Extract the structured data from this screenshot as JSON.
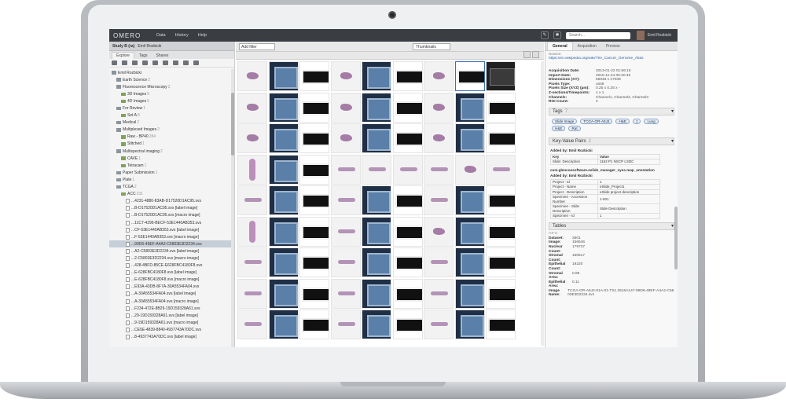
{
  "app": {
    "logo": "OMERO",
    "menu": [
      "Data",
      "History",
      "Help"
    ],
    "search_placeholder": "Search...",
    "user_name": "Emil Rozbicki"
  },
  "left": {
    "header_title": "Study B (ra)",
    "header_user": "Emil Rozbicki",
    "tabs": [
      "Explore",
      "Tags",
      "Shares"
    ],
    "tree": [
      {
        "indent": 0,
        "type": "user",
        "label": "Emil Rozbicki",
        "count": ""
      },
      {
        "indent": 1,
        "type": "folder-gray",
        "label": "Earth Science",
        "count": "2"
      },
      {
        "indent": 1,
        "type": "folder-gray",
        "label": "Fluorescence Microscopy",
        "count": "2"
      },
      {
        "indent": 2,
        "type": "folder-green",
        "label": "3D Images",
        "count": "5"
      },
      {
        "indent": 2,
        "type": "folder-green",
        "label": "4D Images",
        "count": "5"
      },
      {
        "indent": 1,
        "type": "folder-gray",
        "label": "For Review",
        "count": "1"
      },
      {
        "indent": 2,
        "type": "folder-green",
        "label": "Set A",
        "count": "8"
      },
      {
        "indent": 1,
        "type": "folder-gray",
        "label": "Medical",
        "count": "2"
      },
      {
        "indent": 1,
        "type": "folder-gray",
        "label": "Multiplexed Images",
        "count": "2"
      },
      {
        "indent": 2,
        "type": "folder-green",
        "label": "Raw - BP40",
        "count": "284"
      },
      {
        "indent": 2,
        "type": "folder-green",
        "label": "Stitched",
        "count": "1"
      },
      {
        "indent": 1,
        "type": "folder-gray",
        "label": "Multispectral imaging",
        "count": "2"
      },
      {
        "indent": 2,
        "type": "folder-green",
        "label": "CAVE",
        "count": "1"
      },
      {
        "indent": 2,
        "type": "folder-green",
        "label": "Tetracam",
        "count": "1"
      },
      {
        "indent": 1,
        "type": "folder-gray",
        "label": "Paper Submission",
        "count": "1"
      },
      {
        "indent": 1,
        "type": "folder-gray",
        "label": "Plate",
        "count": "1"
      },
      {
        "indent": 1,
        "type": "folder-gray",
        "label": "TCGA",
        "count": "2"
      },
      {
        "indent": 2,
        "type": "folder-green",
        "label": "ACC",
        "count": "231"
      },
      {
        "indent": 3,
        "type": "file",
        "label": "...4231-4880-83AB-D17520D1AC95.svs",
        "count": ""
      },
      {
        "indent": 3,
        "type": "file",
        "label": "...B-D17520D1AC95.svs [label image]",
        "count": ""
      },
      {
        "indent": 3,
        "type": "file",
        "label": "...B-D17520D1AC95.svs [macro image]",
        "count": ""
      },
      {
        "indent": 3,
        "type": "file",
        "label": "...11C7-4296-BECF-53E1440AB353.svs",
        "count": ""
      },
      {
        "indent": 3,
        "type": "file",
        "label": "...CF-53E1440AB353.svs [label image]",
        "count": ""
      },
      {
        "indent": 3,
        "type": "file",
        "label": "...F-53E1440AB353.svs [macro image]",
        "count": ""
      },
      {
        "indent": 3,
        "type": "file",
        "label": "...99D6-49EF-A4A2-C5803E3D2234.svs",
        "count": "",
        "selected": true
      },
      {
        "indent": 3,
        "type": "file",
        "label": "...A2-C5803E3D2234.svs [label image]",
        "count": ""
      },
      {
        "indent": 3,
        "type": "file",
        "label": "...2-C5803E3D2234.svs [macro image]",
        "count": ""
      },
      {
        "indent": 3,
        "type": "file",
        "label": "...428-4BFD-85CE-E628FBC4180F8.svs",
        "count": ""
      },
      {
        "indent": 3,
        "type": "file",
        "label": "...E-628FBC4180F8.svs [label image]",
        "count": ""
      },
      {
        "indent": 3,
        "type": "file",
        "label": "...E-628FBC4180F8.svs [macro image]",
        "count": ""
      },
      {
        "indent": 3,
        "type": "file",
        "label": "...E93A-43DB-8F7A-30A5534FA04.svs",
        "count": ""
      },
      {
        "indent": 3,
        "type": "file",
        "label": "...A-30A55534FA04.svs [label image]",
        "count": ""
      },
      {
        "indent": 3,
        "type": "file",
        "label": "...A-30A55534FA04.svs [macro image]",
        "count": ""
      },
      {
        "indent": 3,
        "type": "file",
        "label": "...F234-472E-8B29-19D159328A61.svs",
        "count": ""
      },
      {
        "indent": 3,
        "type": "file",
        "label": "...29-19D159328A61.svs [label image]",
        "count": ""
      },
      {
        "indent": 3,
        "type": "file",
        "label": "...9-19D159328A61.svs [macro image]",
        "count": ""
      },
      {
        "indent": 3,
        "type": "file",
        "label": "...CE5E-4839-8840-4937743A70DC.svs",
        "count": ""
      },
      {
        "indent": 3,
        "type": "file",
        "label": "...8-4937743A70DC.svs [label image]",
        "count": ""
      }
    ]
  },
  "center": {
    "filter_label": "Add filter",
    "view_mode": "Thumbnails",
    "thumbnails": [
      "tissue",
      "label",
      "macro",
      "tissue",
      "label",
      "macro",
      "tissue",
      "macro",
      "dark",
      "tissue",
      "label",
      "macro",
      "tissue",
      "label",
      "macro",
      "tissue",
      "label",
      "macro",
      "tissue",
      "label",
      "macro",
      "tissue",
      "label",
      "macro",
      "tissue",
      "label",
      "macro",
      "cells",
      "label",
      "macro",
      "small",
      "small",
      "small",
      "small",
      "tissue",
      "small",
      "small",
      "label",
      "macro",
      "small",
      "label",
      "macro",
      "small",
      "label",
      "macro",
      "cells",
      "label",
      "macro",
      "small",
      "label",
      "macro",
      "tissue",
      "label",
      "macro",
      "small",
      "label",
      "macro",
      "small",
      "label",
      "macro",
      "small",
      "label",
      "macro",
      "small",
      "label",
      "macro",
      "small",
      "label",
      "macro",
      "small",
      "label",
      "macro",
      "small",
      "label",
      "macro",
      "small",
      "label",
      "macro",
      "small",
      "label",
      "macro"
    ],
    "selected_index": 7
  },
  "right": {
    "tabs": [
      "General",
      "Acquisition",
      "Preview"
    ],
    "source_label": "Source:",
    "source_link": "https://en.wikipedia.org/wiki/The_Cancer_Genome_Atlas",
    "meta": [
      {
        "k": "Acquisition Date:",
        "v": "2013-01-22 01:56:15"
      },
      {
        "k": "Import Date:",
        "v": "2015-11-24 05:40:45"
      },
      {
        "k": "Dimensions (XY):",
        "v": "66946 x 27039"
      },
      {
        "k": "Pixels Type:",
        "v": "uint8"
      },
      {
        "k": "Pixels Size (XYZ) (µm):",
        "v": "0.25 x 0.25 x -"
      },
      {
        "k": "Z-sections/Timepoints:",
        "v": "1 x 1"
      },
      {
        "k": "Channels:",
        "v": "Channel1, Channel2, Channel3"
      },
      {
        "k": "ROI Count:",
        "v": "2"
      }
    ],
    "tags_title": "Tags",
    "tags_count": "7",
    "tags": [
      "Slide Image",
      "TCGA-OR-A5J4",
      "H&E",
      "1",
      "Lung",
      "H&E",
      "Rat"
    ],
    "kv_title": "Key-Value Pairs",
    "kv_count": "2",
    "kv1_added": "Added by: Emil Rozbicki",
    "kv_key_hdr": "Key",
    "kv_val_hdr": "Value",
    "kv1": [
      {
        "k": "Slide: Description",
        "v": "1163 P1 NSCP LSDC"
      }
    ],
    "kv2_ns": "com.glencoesoftware.eslide_manager_sync.map_annotation",
    "kv2_added": "Added by: Emil Rozbicki",
    "kv2": [
      {
        "k": "Project - Id",
        "v": "1"
      },
      {
        "k": "Project - Name",
        "v": "eSlide_Project1"
      },
      {
        "k": "Project - Description",
        "v": "eSlide project description"
      },
      {
        "k": "Specimen - Accession Number",
        "v": "1-001"
      },
      {
        "k": "Specimen - Slide Description",
        "v": "Slide Description"
      },
      {
        "k": "Specimen - Id",
        "v": "1"
      }
    ],
    "tables_title": "Tables",
    "tables_info": "INFO",
    "table_meta": [
      {
        "k": "Dataset:",
        "v": "2601"
      },
      {
        "k": "Image:",
        "v": "156646"
      },
      {
        "k": "Nuclear Count:",
        "v": "179737"
      },
      {
        "k": "Stromal Count:",
        "v": "160517"
      },
      {
        "k": "Epithelial Count:",
        "v": "19220"
      },
      {
        "k": "Stromal Area:",
        "v": "0.89"
      },
      {
        "k": "Epithelial Area:",
        "v": "0.11"
      },
      {
        "k": "Image Name:",
        "v": "TCGA-OR-A5J4-01A-01-TS1.3516A147-99D6-49EF-A4A2-C5803E3D2234.svs"
      }
    ]
  }
}
